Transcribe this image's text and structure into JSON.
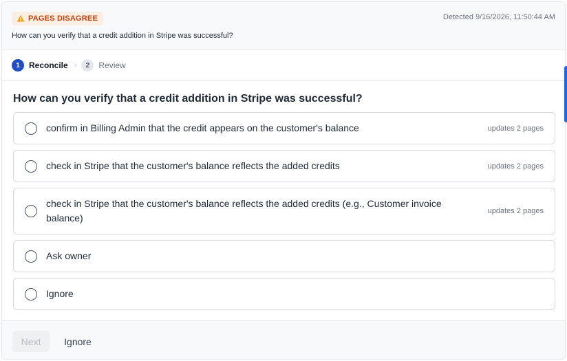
{
  "header": {
    "badge_label": "PAGES DISAGREE",
    "badge_icon": "warning-icon",
    "detected": "Detected 9/16/2026, 11:50:44 AM",
    "question": "How can you verify that a credit addition in Stripe was successful?"
  },
  "steps": [
    {
      "number": "1",
      "label": "Reconcile",
      "active": true
    },
    {
      "number": "2",
      "label": "Review",
      "active": false
    }
  ],
  "main": {
    "question": "How can you verify that a credit addition in Stripe was successful?",
    "options": [
      {
        "label": "confirm in Billing Admin that the credit appears on the customer's balance",
        "meta": "updates 2 pages"
      },
      {
        "label": "check in Stripe that the customer's balance reflects the added credits",
        "meta": "updates 2 pages"
      },
      {
        "label": "check in Stripe that the customer's balance reflects the added credits (e.g., Customer invoice balance)",
        "meta": "updates 2 pages"
      },
      {
        "label": "Ask owner",
        "meta": ""
      },
      {
        "label": "Ignore",
        "meta": ""
      }
    ]
  },
  "footer": {
    "next_label": "Next",
    "ignore_label": "Ignore"
  },
  "colors": {
    "accent": "#1e4fc8",
    "badge_bg": "#fdeee3",
    "badge_text": "#c2410c",
    "warning_icon": "#f59e0b"
  }
}
